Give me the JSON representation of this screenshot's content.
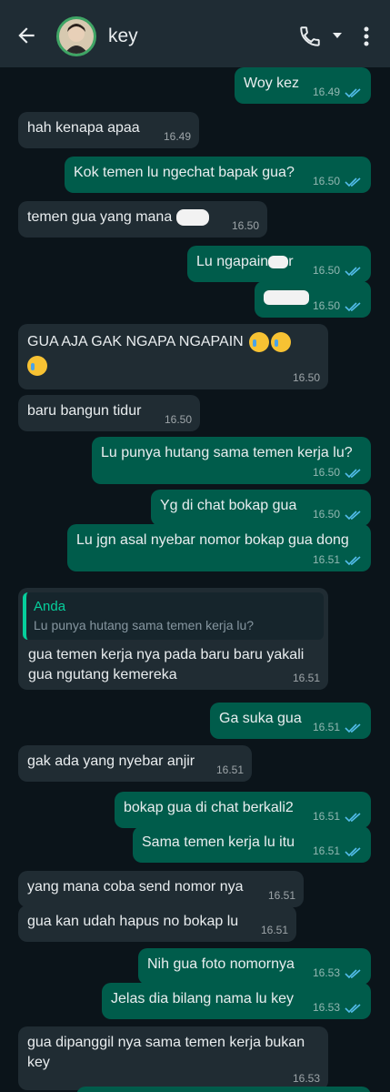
{
  "header": {
    "title": "key"
  },
  "messages": [
    {
      "text": "Woy kez",
      "time": "16.49"
    },
    {
      "text": "hah kenapa apaa",
      "time": "16.49"
    },
    {
      "text": "Kok temen lu ngechat bapak gua?",
      "time": "16.50"
    },
    {
      "text": "temen gua yang mana",
      "time": "16.50"
    },
    {
      "text": "Lu ngapain",
      "text2": "r",
      "time": "16.50"
    },
    {
      "text": "",
      "time": "16.50"
    },
    {
      "text": "GUA AJA GAK NGAPA NGAPAIN",
      "time": "16.50"
    },
    {
      "text": "baru bangun tidur",
      "time": "16.50"
    },
    {
      "text": "Lu punya hutang sama temen kerja lu?",
      "time": "16.50"
    },
    {
      "text": "Yg di chat bokap gua",
      "time": "16.50"
    },
    {
      "text": "Lu jgn asal nyebar nomor bokap gua dong",
      "time": "16.51"
    },
    {
      "quote_name": "Anda",
      "quote_text": "Lu punya hutang sama temen kerja lu?",
      "line1": "gua temen kerja nya pada baru baru yakali",
      "line2": "gua ngutang kemereka",
      "time": "16.51"
    },
    {
      "text": "Ga suka gua",
      "time": "16.51"
    },
    {
      "text": "gak ada yang nyebar anjir",
      "time": "16.51"
    },
    {
      "text": "bokap gua di chat berkali2",
      "time": "16.51"
    },
    {
      "text": "Sama temen kerja lu itu",
      "time": "16.51"
    },
    {
      "text": "yang mana coba send nomor nya",
      "time": "16.51"
    },
    {
      "text": "gua kan udah hapus no bokap lu",
      "time": "16.51"
    },
    {
      "text": "Nih gua foto nomornya",
      "time": "16.53"
    },
    {
      "text": "Jelas dia bilang nama lu key",
      "time": "16.53"
    },
    {
      "line1": "gua dipanggil nya sama temen kerja bukan",
      "line2": "key",
      "time": "16.53"
    }
  ]
}
